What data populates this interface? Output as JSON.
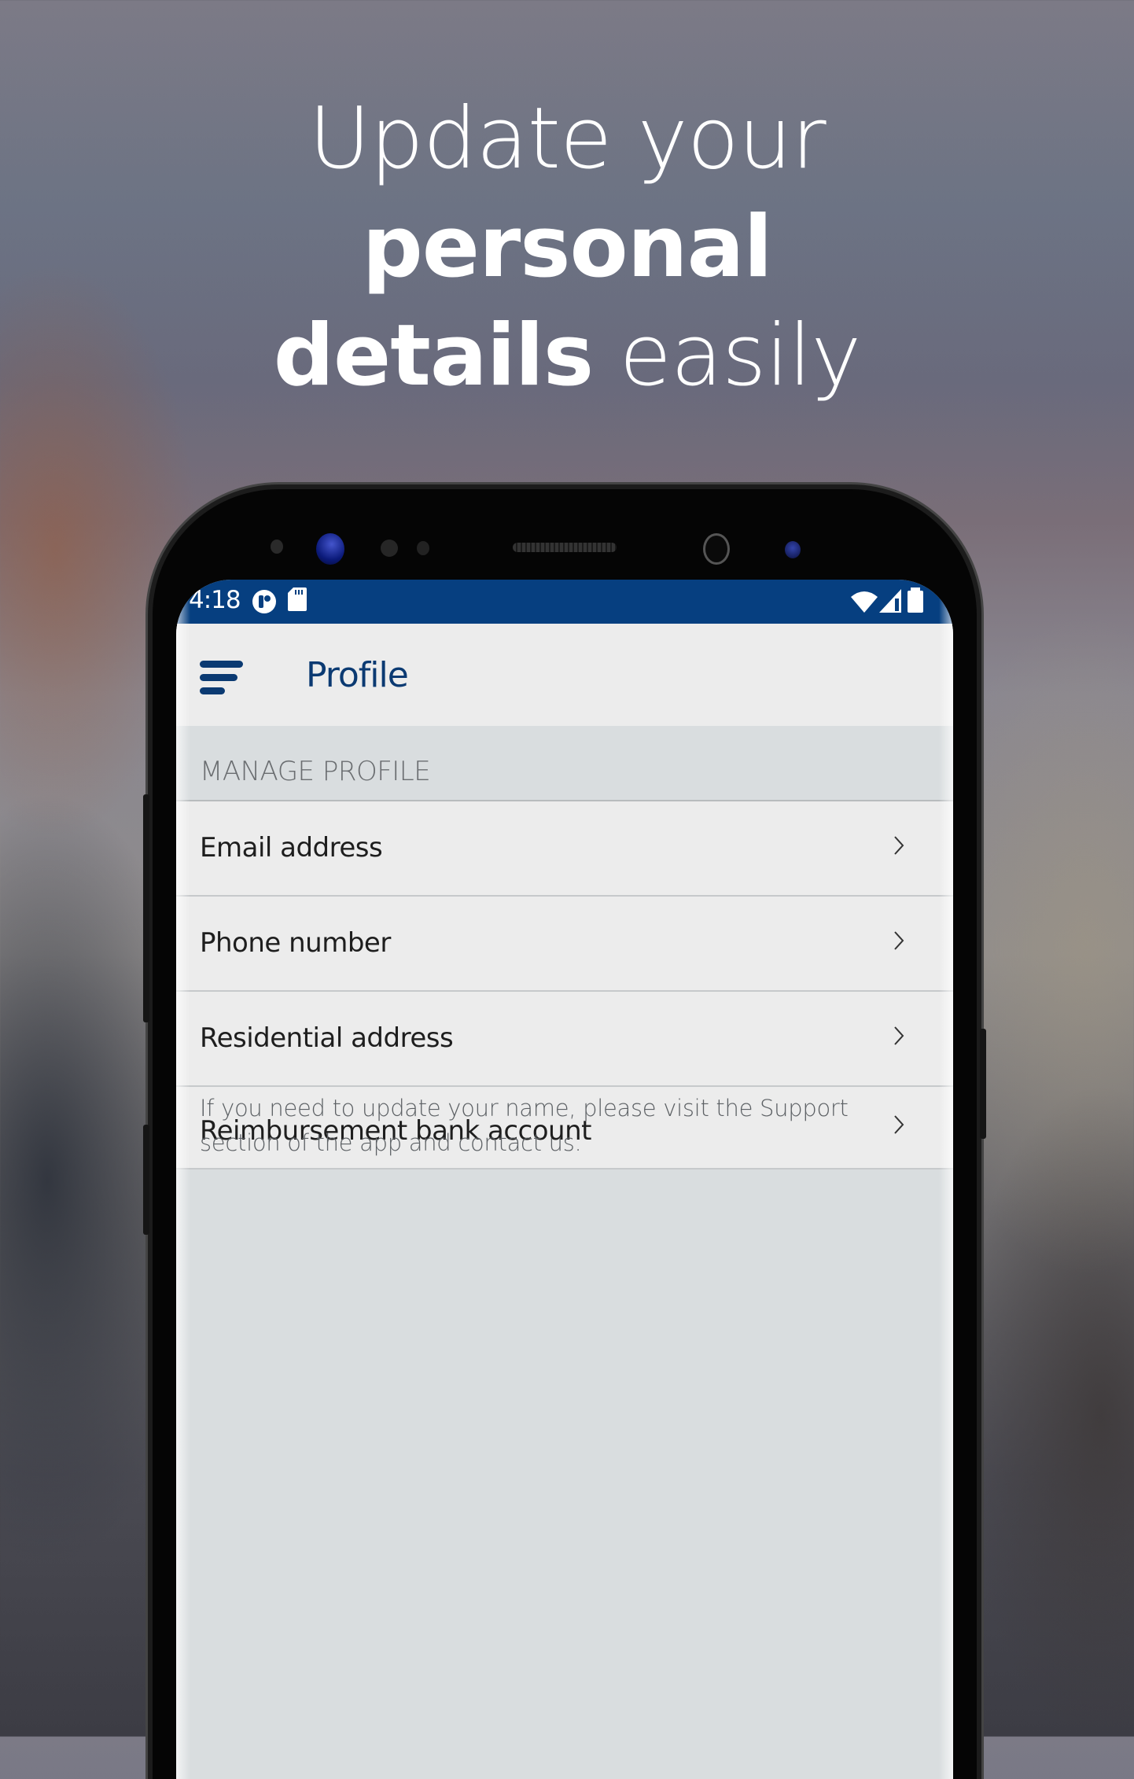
{
  "promo": {
    "headline_line1": "Update your",
    "headline_line2_bold": "personal",
    "headline_line3_bold": "details",
    "headline_line3_light": "easily"
  },
  "status_bar": {
    "time": "4:18",
    "icons": [
      "app-notification-icon",
      "sd-card-icon",
      "wifi-icon",
      "cellular-signal-icon",
      "battery-icon"
    ],
    "background_color": "#063f80"
  },
  "app_bar": {
    "menu_icon": "menu-icon",
    "title": "Profile",
    "accent_color": "#0b3a72"
  },
  "section": {
    "header": "MANAGE PROFILE"
  },
  "profile_items": [
    {
      "label": "Email address",
      "icon": "chevron-right-icon"
    },
    {
      "label": "Phone number",
      "icon": "chevron-right-icon"
    },
    {
      "label": "Residential address",
      "icon": "chevron-right-icon"
    },
    {
      "label": "Reimbursement bank account",
      "icon": "chevron-right-icon"
    }
  ],
  "note": "If you need to update your name, please visit the Support section of the app and contact us."
}
